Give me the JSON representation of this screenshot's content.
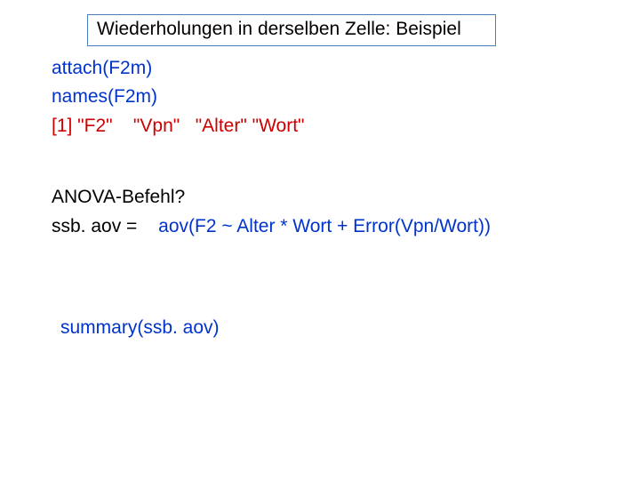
{
  "title": "Wiederholungen in derselben Zelle: Beispiel",
  "lines": {
    "attach": "attach(F2m)",
    "names": "names(F2m)",
    "out1": "[1] \"F2\"    \"Vpn\"   \"Alter\" \"Wort\"",
    "q": "ANOVA-Befehl?",
    "assign_lhs": "ssb. aov = ",
    "assign_rhs": "aov(F2 ~ Alter * Wort + Error(Vpn/Wort))",
    "summary": "summary(ssb. aov)"
  },
  "colors": {
    "blue": "#0033cc",
    "red": "#cc0000",
    "border": "#4a7ebb"
  }
}
